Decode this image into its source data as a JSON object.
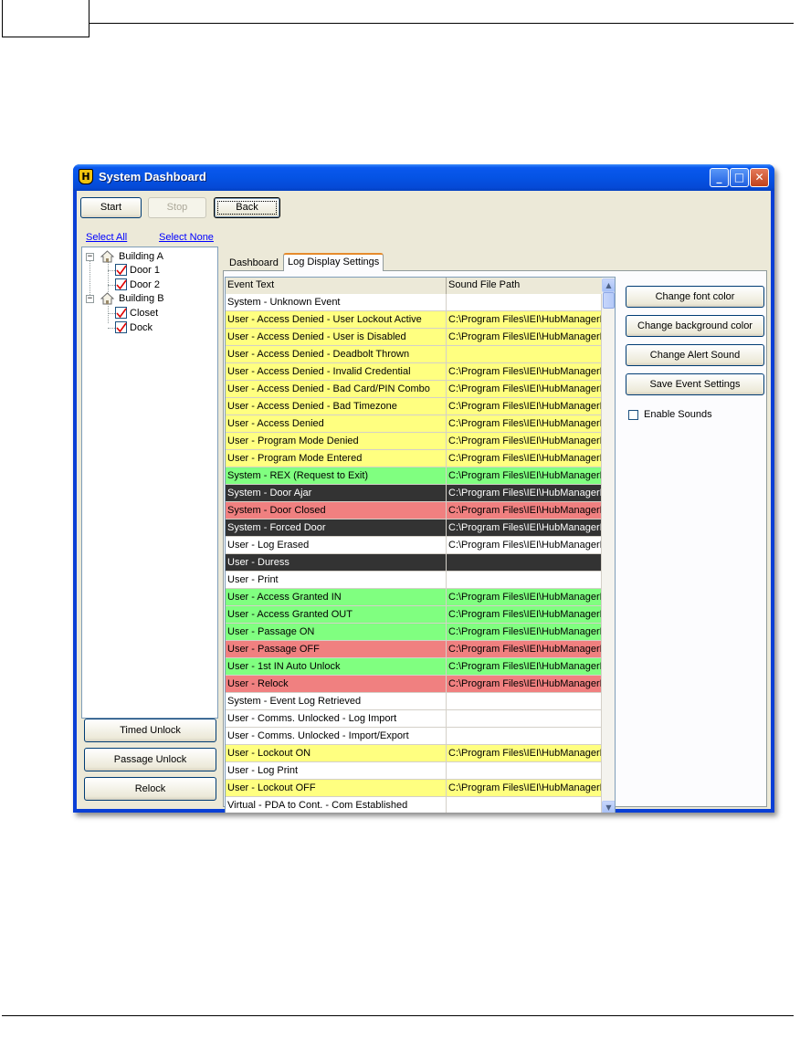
{
  "window": {
    "title": "System Dashboard"
  },
  "toolbar": {
    "start": "Start",
    "stop": "Stop",
    "back": "Back"
  },
  "selection": {
    "select_all": "Select All",
    "select_none": "Select None"
  },
  "tree": {
    "buildings": [
      {
        "label": "Building A",
        "doors": [
          "Door 1",
          "Door 2"
        ]
      },
      {
        "label": "Building B",
        "doors": [
          "Closet",
          "Dock"
        ]
      }
    ]
  },
  "left_buttons": {
    "timed_unlock": "Timed Unlock",
    "passage_unlock": "Passage Unlock",
    "relock": "Relock"
  },
  "tabs": [
    {
      "label": "Dashboard"
    },
    {
      "label": "Log Display Settings",
      "active": true
    }
  ],
  "grid": {
    "columns": [
      "Event Text",
      "Sound File Path"
    ],
    "rows": [
      {
        "event": "System - Unknown Event",
        "path": "",
        "bg": "#ffffff",
        "fg": "#000000"
      },
      {
        "event": "User - Access Denied - User Lockout Active",
        "path": "C:\\Program Files\\IEI\\HubManagerF",
        "bg": "#ffff80",
        "fg": "#000000"
      },
      {
        "event": "User - Access Denied - User is Disabled",
        "path": "C:\\Program Files\\IEI\\HubManagerF",
        "bg": "#ffff80",
        "fg": "#000000"
      },
      {
        "event": "User - Access Denied - Deadbolt Thrown",
        "path": "",
        "bg": "#ffff80",
        "fg": "#000000"
      },
      {
        "event": "User - Access Denied - Invalid Credential",
        "path": "C:\\Program Files\\IEI\\HubManagerF",
        "bg": "#ffff80",
        "fg": "#000000"
      },
      {
        "event": "User - Access Denied - Bad Card/PIN Combo",
        "path": "C:\\Program Files\\IEI\\HubManagerF",
        "bg": "#ffff80",
        "fg": "#000000"
      },
      {
        "event": "User - Access Denied - Bad Timezone",
        "path": "C:\\Program Files\\IEI\\HubManagerF",
        "bg": "#ffff80",
        "fg": "#000000"
      },
      {
        "event": "User - Access Denied",
        "path": "C:\\Program Files\\IEI\\HubManagerF",
        "bg": "#ffff80",
        "fg": "#000000"
      },
      {
        "event": "User - Program Mode Denied",
        "path": "C:\\Program Files\\IEI\\HubManagerF",
        "bg": "#ffff80",
        "fg": "#000000"
      },
      {
        "event": "User - Program Mode Entered",
        "path": "C:\\Program Files\\IEI\\HubManagerF",
        "bg": "#ffff80",
        "fg": "#000000"
      },
      {
        "event": "System - REX (Request to Exit)",
        "path": "C:\\Program Files\\IEI\\HubManagerF",
        "bg": "#80ff80",
        "fg": "#000000"
      },
      {
        "event": "System - Door Ajar",
        "path": "C:\\Program Files\\IEI\\HubManagerF",
        "bg": "#333333",
        "fg": "#ffffff"
      },
      {
        "event": "System - Door Closed",
        "path": "C:\\Program Files\\IEI\\HubManagerF",
        "bg": "#f08080",
        "fg": "#000000"
      },
      {
        "event": "System - Forced Door",
        "path": "C:\\Program Files\\IEI\\HubManagerF",
        "bg": "#333333",
        "fg": "#ffffff"
      },
      {
        "event": "User - Log Erased",
        "path": "C:\\Program Files\\IEI\\HubManagerF",
        "bg": "#ffffff",
        "fg": "#000000"
      },
      {
        "event": "User - Duress",
        "path": "",
        "bg": "#333333",
        "fg": "#ffffff"
      },
      {
        "event": "User - Print",
        "path": "",
        "bg": "#ffffff",
        "fg": "#000000"
      },
      {
        "event": "User - Access Granted IN",
        "path": "C:\\Program Files\\IEI\\HubManagerF",
        "bg": "#80ff80",
        "fg": "#000000"
      },
      {
        "event": "User - Access Granted OUT",
        "path": "C:\\Program Files\\IEI\\HubManagerF",
        "bg": "#80ff80",
        "fg": "#000000"
      },
      {
        "event": "User - Passage ON",
        "path": "C:\\Program Files\\IEI\\HubManagerF",
        "bg": "#80ff80",
        "fg": "#000000"
      },
      {
        "event": "User - Passage OFF",
        "path": "C:\\Program Files\\IEI\\HubManagerF",
        "bg": "#f08080",
        "fg": "#000000"
      },
      {
        "event": "User - 1st IN Auto Unlock",
        "path": "C:\\Program Files\\IEI\\HubManagerF",
        "bg": "#80ff80",
        "fg": "#000000"
      },
      {
        "event": "User - Relock",
        "path": "C:\\Program Files\\IEI\\HubManagerF",
        "bg": "#f08080",
        "fg": "#000000"
      },
      {
        "event": "System - Event Log Retrieved",
        "path": "",
        "bg": "#ffffff",
        "fg": "#000000"
      },
      {
        "event": "User - Comms. Unlocked - Log Import",
        "path": "",
        "bg": "#ffffff",
        "fg": "#000000"
      },
      {
        "event": "User - Comms. Unlocked - Import/Export",
        "path": "",
        "bg": "#ffffff",
        "fg": "#000000"
      },
      {
        "event": "User - Lockout ON",
        "path": "C:\\Program Files\\IEI\\HubManagerF",
        "bg": "#ffff80",
        "fg": "#000000"
      },
      {
        "event": "User - Log Print",
        "path": "",
        "bg": "#ffffff",
        "fg": "#000000"
      },
      {
        "event": "User - Lockout OFF",
        "path": "C:\\Program Files\\IEI\\HubManagerF",
        "bg": "#ffff80",
        "fg": "#000000"
      },
      {
        "event": "Virtual - PDA to Cont. - Com Established",
        "path": "",
        "bg": "#ffffff",
        "fg": "#000000"
      }
    ]
  },
  "right_buttons": {
    "change_font_color": "Change font color",
    "change_background_color": "Change background color",
    "change_alert_sound": "Change Alert Sound",
    "save_event_settings": "Save Event Settings"
  },
  "enable_sounds": {
    "label": "Enable Sounds",
    "checked": false
  },
  "colors": {
    "titlebar": "#0553e4",
    "client": "#ece9d8",
    "tab_accent": "#e68b2c",
    "link": "#0000ff"
  }
}
